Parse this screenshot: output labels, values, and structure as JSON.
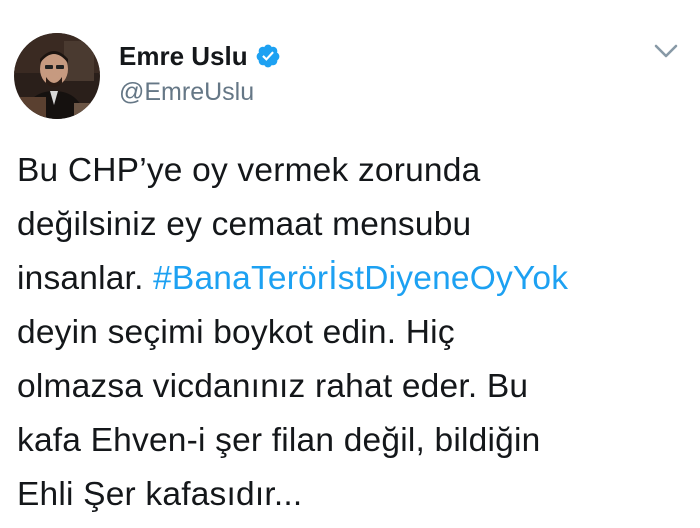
{
  "author": {
    "display_name": "Emre Uslu",
    "handle": "@EmreUslu",
    "verified": true
  },
  "icons": {
    "verified": "verified-badge-icon",
    "menu": "chevron-down-icon"
  },
  "colors": {
    "hashtag": "#1da1f2",
    "text": "#14171a",
    "secondary": "#657786"
  },
  "tweet": {
    "line1": "Bu CHP’ye oy vermek zorunda",
    "line2": "değilsiniz ey cemaat mensubu",
    "line3_prefix": "insanlar. ",
    "hashtag": "#BanaTerörİstDiyeneOyYok",
    "line4": "deyin seçimi boykot edin. Hiç",
    "line5": "olmazsa vicdanınız rahat eder. Bu",
    "line6": "kafa Ehven-i şer filan değil, bildiğin",
    "line7": "Ehli Şer kafasıdır..."
  }
}
